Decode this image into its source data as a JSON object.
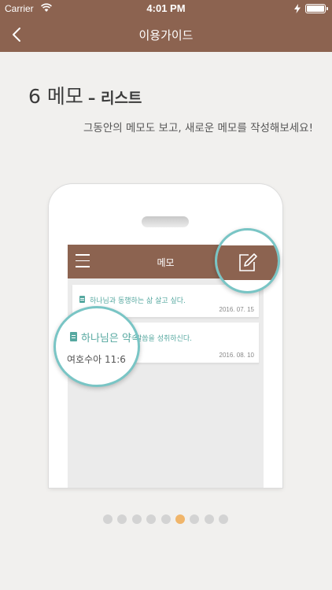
{
  "status_bar": {
    "carrier": "Carrier",
    "time": "4:01 PM"
  },
  "nav": {
    "title": "이용가이드",
    "back_icon": "chevron-left-icon"
  },
  "guide": {
    "heading": "6 메모",
    "subheading": "– 리스트",
    "description": "그동안의 메모도 보고, 새로운 메모를 작성해보세요!"
  },
  "phone_mockup": {
    "app_title": "메모",
    "menu_icon": "hamburger-icon",
    "edit_icon": "edit-icon",
    "memos": [
      {
        "text": "하나님과 동행하는 삶 살고 싶다.",
        "date": "2016. 07. 15"
      },
      {
        "text": "말씀을 성취하신다.",
        "date": "2016. 08. 10"
      }
    ],
    "magnified_memo": {
      "text": "하나님은 약속",
      "reference": "여호수아 11:6"
    }
  },
  "pagination": {
    "count": 9,
    "active_index": 5
  },
  "colors": {
    "brand": "#8c6350",
    "accent": "#79c5c5",
    "memo_text": "#56a8a0",
    "active_dot": "#f0b56a",
    "inactive_dot": "#d3d3d3"
  }
}
